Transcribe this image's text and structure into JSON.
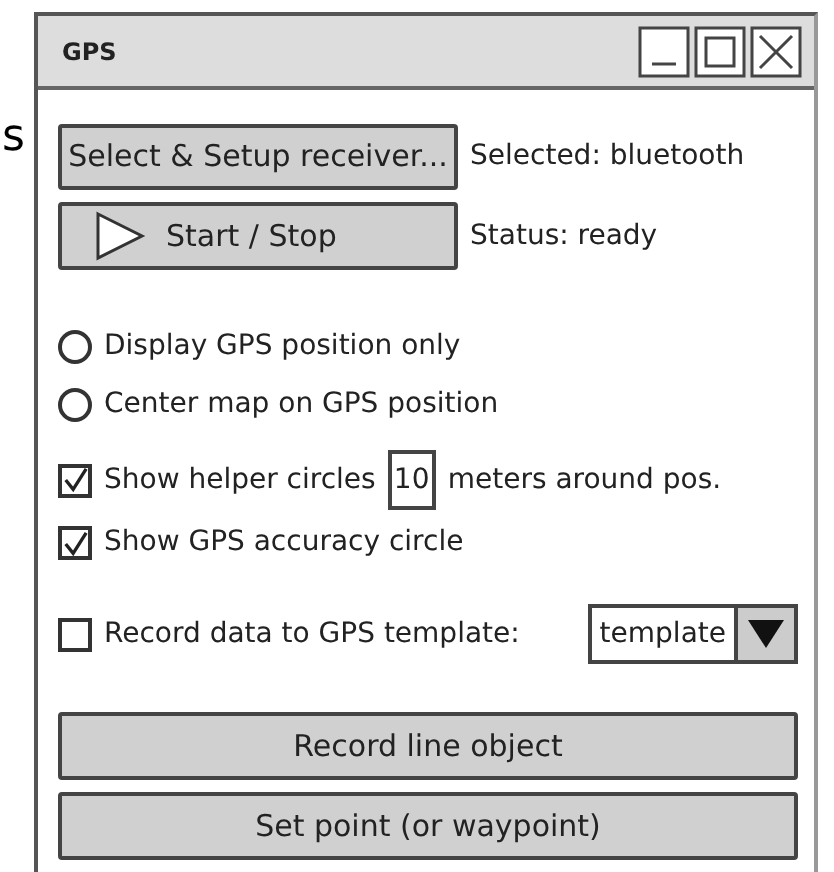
{
  "edge_text": "s",
  "window": {
    "title": "GPS"
  },
  "receiver": {
    "button": "Select & Setup receiver...",
    "selected_label": "Selected: bluetooth"
  },
  "start": {
    "button": "Start / Stop",
    "status": "Status: ready"
  },
  "radios": [
    {
      "label": "Display GPS position only",
      "selected": false
    },
    {
      "label": "Center map on GPS position",
      "selected": false
    }
  ],
  "helper_circles": {
    "checked": true,
    "label": "Show helper circles",
    "value": "10",
    "suffix": "meters around pos."
  },
  "accuracy_circle": {
    "checked": true,
    "label": "Show GPS accuracy circle"
  },
  "record": {
    "checked": false,
    "label": "Record data to GPS template:",
    "template": "template"
  },
  "buttons": [
    "Record line object",
    "Set point (or waypoint)"
  ]
}
